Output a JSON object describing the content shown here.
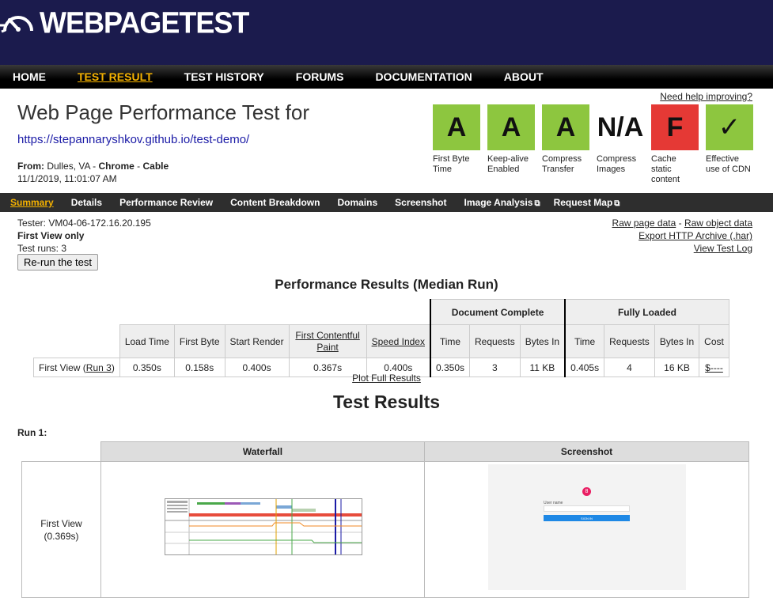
{
  "logo": {
    "text_bold": "WEB",
    "text_rest": "PAGETEST",
    "icon": "speedometer-icon"
  },
  "topnav": [
    {
      "label": "HOME",
      "active": false
    },
    {
      "label": "TEST RESULT",
      "active": true
    },
    {
      "label": "TEST HISTORY",
      "active": false
    },
    {
      "label": "FORUMS",
      "active": false
    },
    {
      "label": "DOCUMENTATION",
      "active": false
    },
    {
      "label": "ABOUT",
      "active": false
    }
  ],
  "page": {
    "title": "Web Page Performance Test for",
    "url": "https://stepannaryshkov.github.io/test-demo/",
    "from_label": "From:",
    "from_location": "Dulles, VA",
    "sep": " - ",
    "browser": "Chrome",
    "connection": "Cable",
    "date": "11/1/2019, 11:01:07 AM",
    "help_link": "Need help improving?"
  },
  "grades": [
    {
      "grade": "A",
      "label": "First Byte Time",
      "color": "#8dc63f"
    },
    {
      "grade": "A",
      "label": "Keep-alive Enabled",
      "color": "#8dc63f"
    },
    {
      "grade": "A",
      "label": "Compress Transfer",
      "color": "#8dc63f"
    },
    {
      "grade": "N/A",
      "label": "Compress Images",
      "color": "#ffffff"
    },
    {
      "grade": "F",
      "label": "Cache static content",
      "color": "#e53935"
    },
    {
      "grade": "✓",
      "label": "Effective use of CDN",
      "color": "#8dc63f"
    }
  ],
  "subnav": [
    {
      "label": "Summary",
      "active": true,
      "ext": false
    },
    {
      "label": "Details",
      "active": false,
      "ext": false
    },
    {
      "label": "Performance Review",
      "active": false,
      "ext": false
    },
    {
      "label": "Content Breakdown",
      "active": false,
      "ext": false
    },
    {
      "label": "Domains",
      "active": false,
      "ext": false
    },
    {
      "label": "Screenshot",
      "active": false,
      "ext": false
    },
    {
      "label": "Image Analysis",
      "active": false,
      "ext": true
    },
    {
      "label": "Request Map",
      "active": false,
      "ext": true
    }
  ],
  "tester": {
    "line": "Tester: VM04-06-172.16.20.195",
    "view": "First View only",
    "runs": "Test runs: 3",
    "rerun": "Re-run the test"
  },
  "rightlinks": {
    "raw_page": "Raw page data",
    "dash": " - ",
    "raw_object": "Raw object data",
    "export": "Export HTTP Archive (.har)",
    "log": "View Test Log"
  },
  "perf": {
    "heading": "Performance Results (Median Run)",
    "group_doc": "Document Complete",
    "group_full": "Fully Loaded",
    "cols": [
      "Load Time",
      "First Byte",
      "Start Render",
      "First Contentful Paint",
      "Speed Index",
      "Time",
      "Requests",
      "Bytes In",
      "Time",
      "Requests",
      "Bytes In",
      "Cost"
    ],
    "row_label": "First View (",
    "row_link": "Run 3",
    "row_close": ")",
    "values": [
      "0.350s",
      "0.158s",
      "0.400s",
      "0.367s",
      "0.400s",
      "0.350s",
      "3",
      "11 KB",
      "0.405s",
      "4",
      "16 KB",
      "$----"
    ],
    "plot_link": "Plot Full Results"
  },
  "test_results": {
    "heading": "Test Results",
    "run": "Run 1:",
    "waterfall": "Waterfall",
    "screenshot": "Screenshot",
    "fv_label": "First View",
    "fv_time": "(0.369s)"
  },
  "screenshot_content": {
    "badge": "8",
    "field_label": "User name",
    "button": "SIGN IN"
  },
  "colors": {
    "header": "#1b1b4d",
    "accent": "#f5b200",
    "link": "#1a1aa6"
  }
}
